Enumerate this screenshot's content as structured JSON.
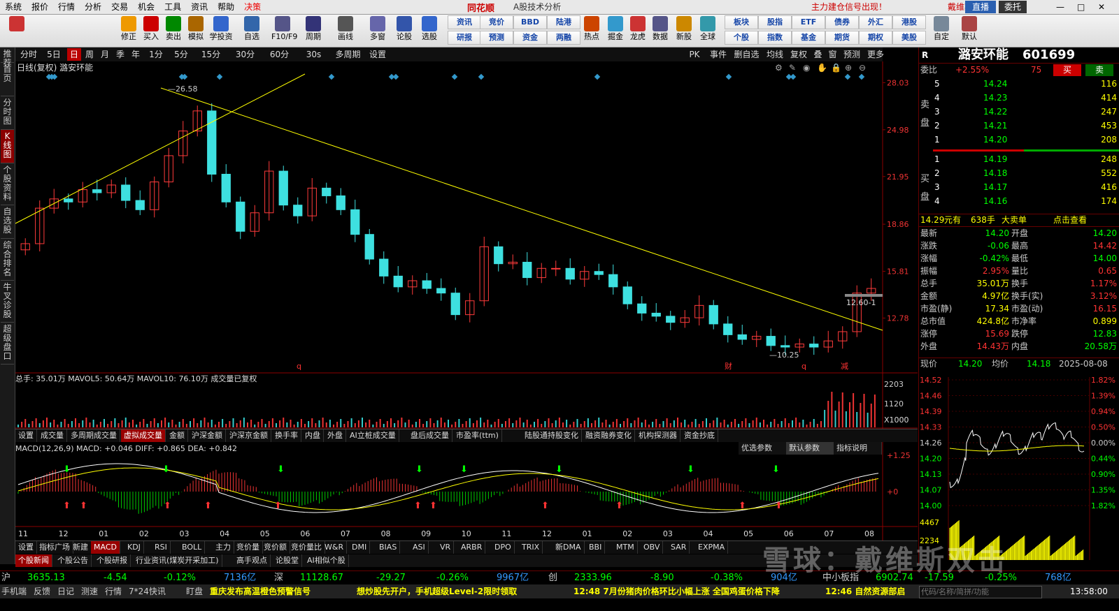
{
  "menubar": {
    "items": [
      "系统",
      "报价",
      "行情",
      "分析",
      "交易",
      "机会",
      "工具",
      "资讯",
      "帮助",
      "决策"
    ],
    "promo": "主力建仓信号出现！",
    "user": "戴维斯双击",
    "live_button": "直播",
    "wtb_button": "委托"
  },
  "toolbar": {
    "buttons": [
      "",
      "修正",
      "买入",
      "卖出",
      "模拟",
      "学投资",
      "自选",
      "F10/F9",
      "周期",
      "画线",
      "多窗",
      "论股",
      "选股",
      "热点",
      "掘金",
      "龙虎",
      "数据",
      "新股",
      "全球",
      "自定",
      "默认"
    ],
    "small_top": [
      "资讯",
      "竞价",
      "BBD",
      "陆港",
      "板块",
      "股指",
      "ETF",
      "债券",
      "外汇",
      "港股"
    ],
    "small_bottom": [
      "研报",
      "预测",
      "资金",
      "两融",
      "个股",
      "指数",
      "基金",
      "期货",
      "期权",
      "美股"
    ],
    "brand": "同花顺",
    "subtitle": "A股技术分析"
  },
  "periodbar": {
    "items": [
      "分时",
      "5日",
      "日",
      "周",
      "月",
      "季",
      "年",
      "1分",
      "5分",
      "15分",
      "30分",
      "60分",
      "30s",
      "多周期",
      "设置"
    ],
    "selected": "日",
    "right_items": [
      "PK",
      "事件",
      "删自选",
      "均线",
      "复权",
      "叠",
      "窗",
      "预测",
      "更多"
    ]
  },
  "leftnav": [
    "推荐",
    "首页",
    "分时图",
    "K线图",
    "个股资料",
    "自选股",
    "综合排名",
    "牛叉诊股",
    "超级盘口"
  ],
  "main_chart": {
    "header": "日线(复权)  潞安环能",
    "price_axis": [
      "28.03",
      "24.98",
      "21.95",
      "18.86",
      "15.81",
      "12.78"
    ],
    "high_label": "26.58",
    "low_label": "10.25",
    "price_tag": "12.60-1",
    "event_marks": [
      "q",
      "财",
      "q",
      "减"
    ],
    "vol_header": "总手: 35.01万  MAVOL5: 50.64万  MAVOL10: 76.10万  成交量已复权",
    "vol_axis": [
      "2203",
      "1120",
      "X1000"
    ],
    "vol_tabs": [
      "设置",
      "成交量",
      "多周期成交量",
      "虚拟成交量",
      "金额",
      "沪深金额",
      "沪深京金额",
      "换手率",
      "内盘",
      "外盘",
      "AI立桩成交量",
      "盘后成交量",
      "市盈率(ttm)",
      "陆股通持股变化",
      "融资融券变化",
      "机构探测器",
      "资金抄底"
    ],
    "vol_tab_selected": "虚拟成交量",
    "macd_header": "MACD(12,26,9)  MACD: +0.046  DIFF: +0.865  DEA: +0.842",
    "macd_axis": [
      "+1.25",
      "+0"
    ],
    "macd_buttons": [
      "优选参数",
      "默认参数",
      "指标说明"
    ],
    "x_axis": [
      "11",
      "12",
      "01",
      "02",
      "03",
      "04",
      "05",
      "06",
      "07",
      "08",
      "09",
      "10",
      "11",
      "12",
      "01",
      "02",
      "03",
      "04",
      "05",
      "06",
      "07",
      "08"
    ],
    "ind_tabs": [
      "设置",
      "指标广场",
      "新建",
      "MACD",
      "KDJ",
      "RSI",
      "BOLL",
      "主力",
      "竞价量",
      "竞价额",
      "竞价量比",
      "W&R",
      "DMI",
      "BIAS",
      "ASI",
      "VR",
      "ARBR",
      "DPO",
      "TRIX",
      "新DMA",
      "BBI",
      "MTM",
      "OBV",
      "SAR",
      "EXPMA"
    ],
    "ind_selected": "MACD",
    "news_tabs": [
      "个股新闻",
      "个股公告",
      "个股研报",
      "行业资讯(煤炭开采加工)",
      "高手观点",
      "论股堂",
      "AI相似个股"
    ]
  },
  "right_panel": {
    "stock_name": "潞安环能",
    "stock_code": "601699",
    "wb_label": "委比",
    "wb_value": "+2.55%",
    "wc_value": "75",
    "buy_btn": "买",
    "sell_btn": "卖",
    "sell_label": "卖盘",
    "buy_label": "买盘",
    "asks": [
      {
        "lvl": "5",
        "price": "14.24",
        "vol": "116"
      },
      {
        "lvl": "4",
        "price": "14.23",
        "vol": "414"
      },
      {
        "lvl": "3",
        "price": "14.22",
        "vol": "247"
      },
      {
        "lvl": "2",
        "price": "14.21",
        "vol": "453"
      },
      {
        "lvl": "1",
        "price": "14.20",
        "vol": "208"
      }
    ],
    "bids": [
      {
        "lvl": "1",
        "price": "14.19",
        "vol": "248"
      },
      {
        "lvl": "2",
        "price": "14.18",
        "vol": "552"
      },
      {
        "lvl": "3",
        "price": "14.17",
        "vol": "416"
      },
      {
        "lvl": "4",
        "price": "14.16",
        "vol": "174"
      }
    ],
    "big_order": {
      "price": "14.29",
      "unit": "元有",
      "vol": "638手",
      "label": "大卖单",
      "link": "点击查看"
    },
    "stats": [
      [
        "最新",
        "14.20",
        "开盘",
        "14.20"
      ],
      [
        "涨跌",
        "-0.06",
        "最高",
        "14.42"
      ],
      [
        "涨幅",
        "-0.42%",
        "最低",
        "14.00"
      ],
      [
        "振幅",
        "2.95%",
        "量比",
        "0.65"
      ],
      [
        "总手",
        "35.01万",
        "换手",
        "1.17%"
      ],
      [
        "金额",
        "4.97亿",
        "换手(实)",
        "3.12%"
      ],
      [
        "市盈(静)",
        "17.34",
        "市盈(动)",
        "16.15"
      ],
      [
        "总市值",
        "424.8亿",
        "市净率",
        "0.899"
      ],
      [
        "涨停",
        "15.69",
        "跌停",
        "12.83"
      ],
      [
        "外盘",
        "14.43万",
        "内盘",
        "20.58万"
      ]
    ],
    "mini_header": {
      "now_label": "现价",
      "now": "14.20",
      "avg_label": "均价",
      "avg": "14.18",
      "date": "2025-08-08"
    },
    "mini_left_axis": [
      "14.52",
      "14.46",
      "14.39",
      "14.33",
      "14.26",
      "14.20",
      "14.13",
      "14.07",
      "14.00"
    ],
    "mini_right_axis": [
      "1.82%",
      "1.39%",
      "0.94%",
      "0.50%",
      "0.00%",
      "0.44%",
      "0.90%",
      "1.35%",
      "1.82%"
    ],
    "mini_vol_axis": [
      "4467",
      "2234"
    ]
  },
  "indexbar": [
    {
      "name": "沪",
      "value": "3635.13",
      "chg": "-4.54",
      "pct": "-0.12%",
      "amt": "7136亿"
    },
    {
      "name": "深",
      "value": "11128.67",
      "chg": "-29.27",
      "pct": "-0.26%",
      "amt": "9967亿"
    },
    {
      "name": "创",
      "value": "2333.96",
      "chg": "-8.90",
      "pct": "-0.38%",
      "amt": "904亿"
    },
    {
      "name": "中小板指",
      "value": "6902.74",
      "chg": "-17.59",
      "pct": "-0.25%",
      "amt": "768亿"
    }
  ],
  "statusbar": {
    "items": [
      "手机端",
      "反馈",
      "日记",
      "测速",
      "行情",
      "7*24快讯",
      "盯盘"
    ],
    "news1": "重庆发布高温橙色预警信号",
    "news2": "想炒股先开户，手机超级Level-2限时领取",
    "news3": "12:48 7月份猪肉价格环比小幅上涨 全国鸡蛋价格下降",
    "news4": "12:46 自然资源部启",
    "search_placeholder": "代码/名称/简拼/功能",
    "time": "13:58:00"
  },
  "watermark": "雪球：戴维斯双击",
  "chart_data": {
    "type": "candlestick",
    "title": "",
    "ylim": [
      9.5,
      28.5
    ],
    "series": [
      {
        "name": "close",
        "values": [
          17.6,
          19.9,
          20.5,
          20.3,
          21.1,
          20.9,
          21.4,
          20.4,
          19.8,
          21.6,
          23.3,
          24.9,
          26.2,
          22.1,
          20.3,
          18.4,
          19.6,
          22.3,
          20.1,
          19.4,
          21.2,
          20.7,
          19.8,
          18.2,
          16.6,
          15.5,
          14.8,
          15.2,
          14.7,
          14.4,
          13.0,
          13.9,
          17.4,
          16.3,
          16.4,
          15.4,
          16.0,
          16.0,
          15.3,
          15.8,
          15.6,
          14.8,
          13.7,
          13.1,
          12.9,
          12.5,
          12.8,
          13.6,
          12.4,
          11.7,
          11.4,
          11.6,
          11.0,
          10.9,
          11.1,
          10.9,
          11.3,
          11.9,
          14.4,
          14.7
        ]
      }
    ]
  }
}
